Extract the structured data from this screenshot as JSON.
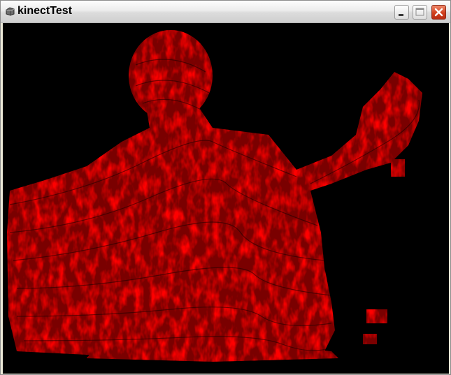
{
  "window": {
    "title": "kinectTest",
    "controls": {
      "minimize": "minimize-icon",
      "maximize": "maximize-icon",
      "close": "close-icon"
    }
  },
  "canvas": {
    "background": "#000000",
    "depth_color": "#ff0000",
    "depth_dark": "#7a0000"
  }
}
